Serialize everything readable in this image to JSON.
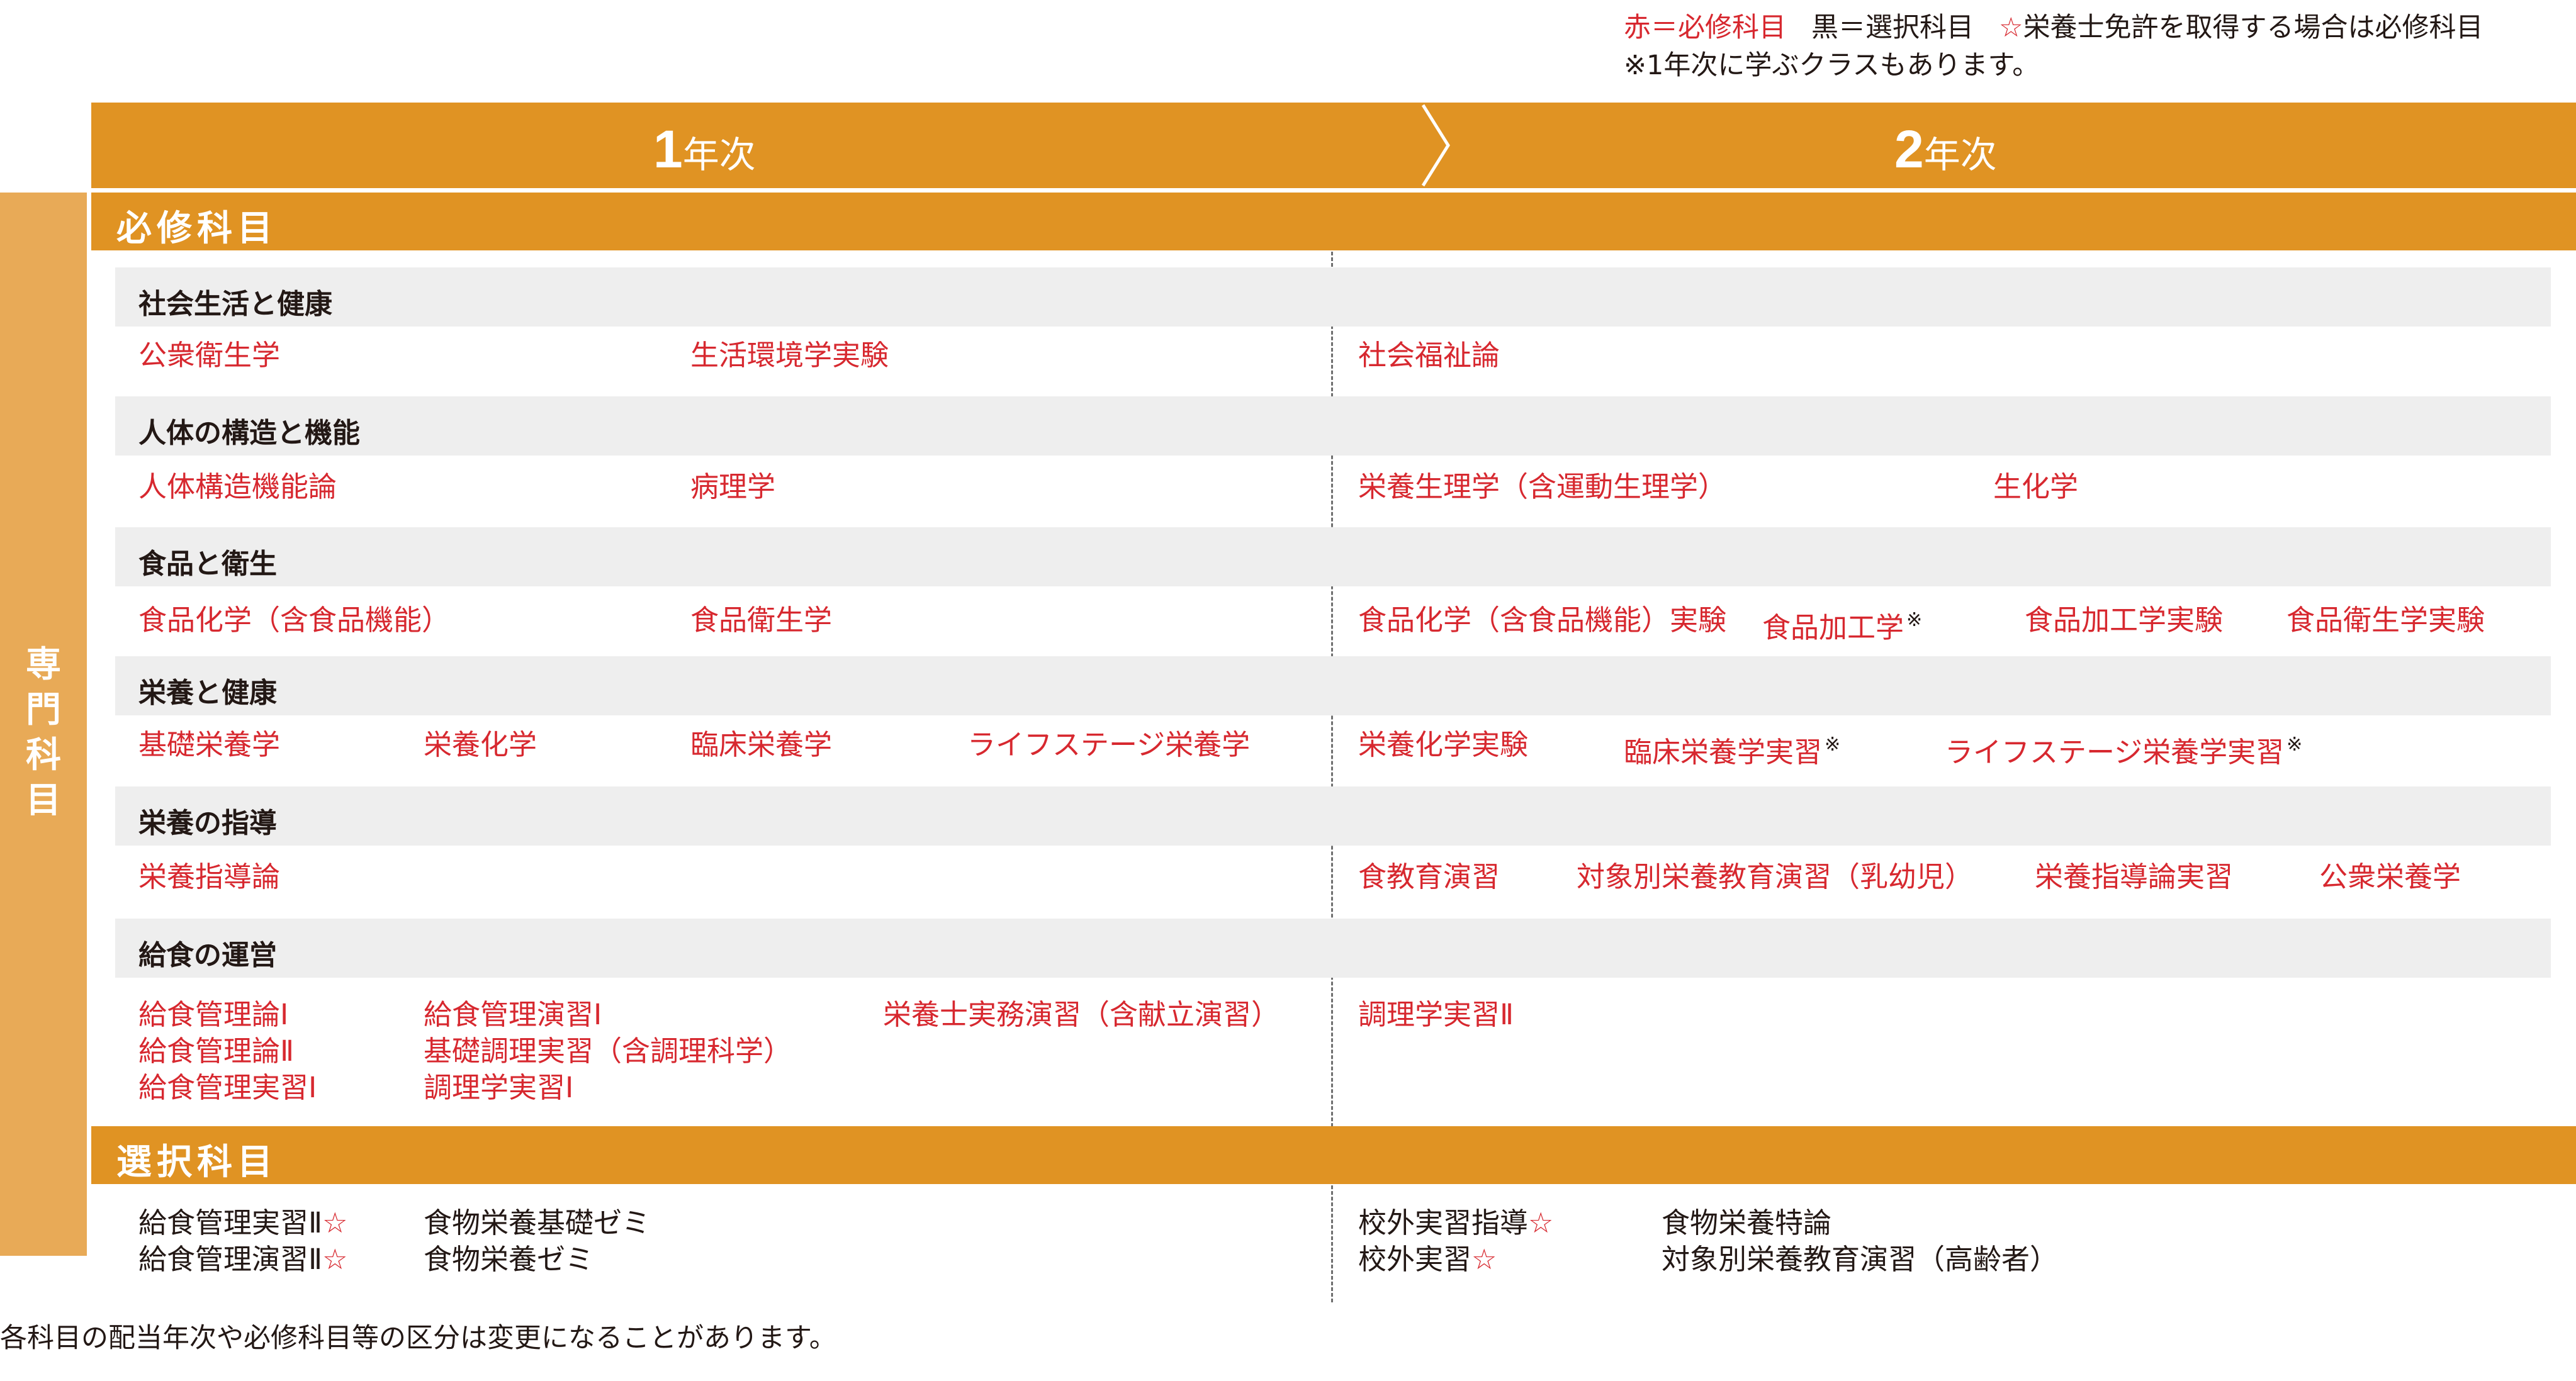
{
  "legend": {
    "required": "赤＝必修科目",
    "elective": "黒＝選択科目",
    "star_prefix": "☆",
    "star_text": "栄養士免許を取得する場合は必修科目",
    "note": "※1年次に学ぶクラスもあります。"
  },
  "years": [
    {
      "num": "1",
      "unit": "年次"
    },
    {
      "num": "2",
      "unit": "年次"
    }
  ],
  "side_label": [
    "専",
    "門",
    "科",
    "目"
  ],
  "sections": {
    "required": "必修科目",
    "elective": "選択科目"
  },
  "categories": [
    {
      "name": "社会生活と健康",
      "year1": [
        "公衆衛生学",
        "生活環境学実験"
      ],
      "year2": [
        "社会福祉論"
      ]
    },
    {
      "name": "人体の構造と機能",
      "year1": [
        "人体構造機能論",
        "病理学"
      ],
      "year2": [
        "栄養生理学（含運動生理学）",
        "生化学"
      ]
    },
    {
      "name": "食品と衛生",
      "year1": [
        "食品化学（含食品機能）",
        "食品衛生学"
      ],
      "year2": [
        "食品化学（含食品機能）実験",
        "食品加工学",
        "食品加工学実験",
        "食品衛生学実験"
      ]
    },
    {
      "name": "栄養と健康",
      "year1": [
        "基礎栄養学",
        "栄養化学",
        "臨床栄養学",
        "ライフステージ栄養学"
      ],
      "year2": [
        "栄養化学実験",
        "臨床栄養学実習",
        "ライフステージ栄養学実習"
      ]
    },
    {
      "name": "栄養の指導",
      "year1": [
        "栄養指導論"
      ],
      "year2": [
        "食教育演習",
        "対象別栄養教育演習（乳幼児）",
        "栄養指導論実習",
        "公衆栄養学"
      ]
    },
    {
      "name": "給食の運営",
      "year1": [
        "給食管理論Ⅰ",
        "給食管理演習Ⅰ",
        "栄養士実務演習（含献立演習）",
        "給食管理論Ⅱ",
        "基礎調理実習（含調理科学）",
        "給食管理実習Ⅰ",
        "調理学実習Ⅰ"
      ],
      "year2": [
        "調理学実習Ⅱ"
      ]
    }
  ],
  "note_mark": "※",
  "electives": {
    "year1": [
      "給食管理実習Ⅱ",
      "食物栄養基礎ゼミ",
      "給食管理演習Ⅱ",
      "食物栄養ゼミ"
    ],
    "year2": [
      "校外実習指導",
      "食物栄養特論",
      "校外実習",
      "対象別栄養教育演習（高齢者）"
    ]
  },
  "star": "☆",
  "footnote": "各科目の配当年次や必修科目等の区分は変更になることがあります。",
  "colors": {
    "orange": "#e09323",
    "light_orange": "#e8aa57",
    "required_red": "#d7282f",
    "grey": "#eeeeee"
  }
}
